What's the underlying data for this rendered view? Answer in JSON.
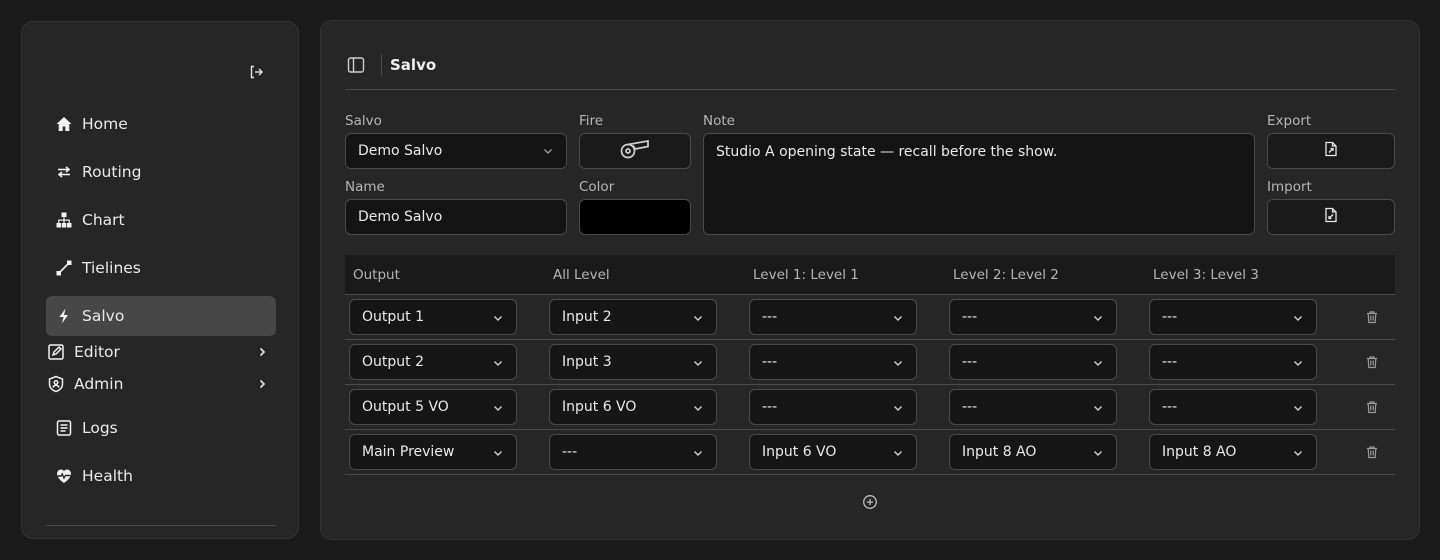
{
  "sidebar": {
    "items": [
      {
        "label": "Home",
        "icon": "home-icon",
        "active": false
      },
      {
        "label": "Routing",
        "icon": "arrows-left-right-icon",
        "active": false
      },
      {
        "label": "Chart",
        "icon": "sitemap-icon",
        "active": false
      },
      {
        "label": "Tielines",
        "icon": "link-diagonal-icon",
        "active": false
      },
      {
        "label": "Salvo",
        "icon": "bolt-icon",
        "active": true
      },
      {
        "label": "Editor",
        "icon": "edit-box-icon",
        "active": false,
        "expandable": true
      },
      {
        "label": "Admin",
        "icon": "shield-user-icon",
        "active": false,
        "expandable": true
      },
      {
        "label": "Logs",
        "icon": "list-doc-icon",
        "active": false
      },
      {
        "label": "Health",
        "icon": "heart-pulse-icon",
        "active": false
      }
    ]
  },
  "header": {
    "title": "Salvo"
  },
  "form": {
    "salvo_label": "Salvo",
    "salvo_value": "Demo Salvo",
    "fire_label": "Fire",
    "note_label": "Note",
    "note_value": "Studio A opening state — recall before the show.",
    "export_label": "Export",
    "import_label": "Import",
    "name_label": "Name",
    "name_value": "Demo Salvo",
    "color_label": "Color",
    "color_value": "#000000"
  },
  "table": {
    "columns": [
      "Output",
      "All Level",
      "Level 1: Level 1",
      "Level 2: Level 2",
      "Level 3: Level 3"
    ],
    "rows": [
      [
        "Output 1",
        "Input 2",
        "---",
        "---",
        "---"
      ],
      [
        "Output 2",
        "Input 3",
        "---",
        "---",
        "---"
      ],
      [
        "Output 5 VO",
        "Input 6 VO",
        "---",
        "---",
        "---"
      ],
      [
        "Main Preview",
        "---",
        "Input 6 VO",
        "Input 8 AO",
        "Input 8 AO"
      ]
    ]
  },
  "colors": {
    "background": "#1b1b1b",
    "panel": "#262626",
    "active_nav": "#474747",
    "border": "#4a4a4a"
  }
}
